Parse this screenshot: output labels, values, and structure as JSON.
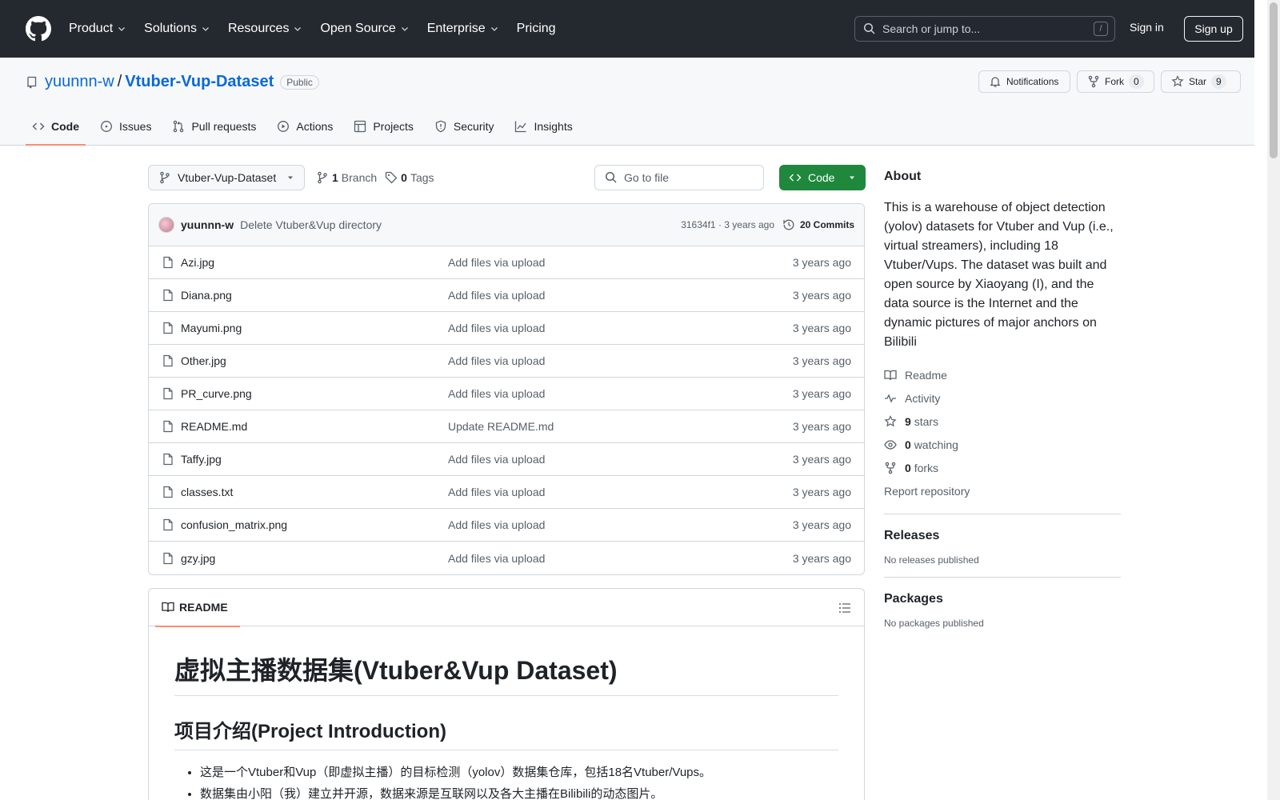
{
  "header": {
    "nav": [
      {
        "label": "Product",
        "has_menu": true
      },
      {
        "label": "Solutions",
        "has_menu": true
      },
      {
        "label": "Resources",
        "has_menu": true
      },
      {
        "label": "Open Source",
        "has_menu": true
      },
      {
        "label": "Enterprise",
        "has_menu": true
      },
      {
        "label": "Pricing",
        "has_menu": false
      }
    ],
    "search_placeholder": "Search or jump to...",
    "search_key": "/",
    "signin": "Sign in",
    "signup": "Sign up"
  },
  "repo": {
    "owner": "yuunnn-w",
    "separator": "/",
    "name": "Vtuber-Vup-Dataset",
    "visibility": "Public",
    "notifications": "Notifications",
    "fork_label": "Fork",
    "fork_count": "0",
    "star_label": "Star",
    "star_count": "9",
    "tabs": [
      {
        "label": "Code",
        "icon": "code-icon",
        "active": true
      },
      {
        "label": "Issues",
        "icon": "issue-icon",
        "active": false
      },
      {
        "label": "Pull requests",
        "icon": "pull-request-icon",
        "active": false
      },
      {
        "label": "Actions",
        "icon": "play-icon",
        "active": false
      },
      {
        "label": "Projects",
        "icon": "table-icon",
        "active": false
      },
      {
        "label": "Security",
        "icon": "shield-icon",
        "active": false
      },
      {
        "label": "Insights",
        "icon": "graph-icon",
        "active": false
      }
    ]
  },
  "filenav": {
    "branch": "Vtuber-Vup-Dataset",
    "branch_count": "1",
    "branch_label": "Branch",
    "tag_count": "0",
    "tag_label": "Tags",
    "goto_placeholder": "Go to file",
    "code_label": "Code"
  },
  "commit": {
    "author": "yuunnn-w",
    "message": "Delete Vtuber&Vup directory",
    "hash": "31634f1",
    "dot": "·",
    "age": "3 years ago",
    "commits": "20 Commits"
  },
  "files": [
    {
      "name": "Azi.jpg",
      "message": "Add files via upload",
      "age": "3 years ago"
    },
    {
      "name": "Diana.png",
      "message": "Add files via upload",
      "age": "3 years ago"
    },
    {
      "name": "Mayumi.png",
      "message": "Add files via upload",
      "age": "3 years ago"
    },
    {
      "name": "Other.jpg",
      "message": "Add files via upload",
      "age": "3 years ago"
    },
    {
      "name": "PR_curve.png",
      "message": "Add files via upload",
      "age": "3 years ago"
    },
    {
      "name": "README.md",
      "message": "Update README.md",
      "age": "3 years ago"
    },
    {
      "name": "Taffy.jpg",
      "message": "Add files via upload",
      "age": "3 years ago"
    },
    {
      "name": "classes.txt",
      "message": "Add files via upload",
      "age": "3 years ago"
    },
    {
      "name": "confusion_matrix.png",
      "message": "Add files via upload",
      "age": "3 years ago"
    },
    {
      "name": "gzy.jpg",
      "message": "Add files via upload",
      "age": "3 years ago"
    }
  ],
  "readme": {
    "tab": "README",
    "h1": "虚拟主播数据集(Vtuber&Vup Dataset)",
    "h2": "项目介绍(Project Introduction)",
    "bullets": [
      "这是一个Vtuber和Vup（即虚拟主播）的目标检测（yolov）数据集仓库，包括18名Vtuber/Vups。",
      "数据集由小阳（我）建立并开源，数据来源是互联网以及各大主播在Bilibili的动态图片。"
    ]
  },
  "sidebar": {
    "about": "About",
    "description": "This is a warehouse of object detection (yolov) datasets for Vtuber and Vup (i.e., virtual streamers), including 18 Vtuber/Vups. The dataset was built and open source by Xiaoyang (I), and the data source is the Internet and the dynamic pictures of major anchors on Bilibili",
    "readme": "Readme",
    "activity": "Activity",
    "stars_count": "9",
    "stars_label": "stars",
    "watching_count": "0",
    "watching_label": "watching",
    "forks_count": "0",
    "forks_label": "forks",
    "report": "Report repository",
    "releases": "Releases",
    "no_releases": "No releases published",
    "packages": "Packages",
    "no_packages": "No packages published"
  },
  "colors": {
    "header_bg": "#24292f",
    "link": "#0969da",
    "code_button": "#1f883d",
    "active_tab_underline": "#fd8c73"
  }
}
